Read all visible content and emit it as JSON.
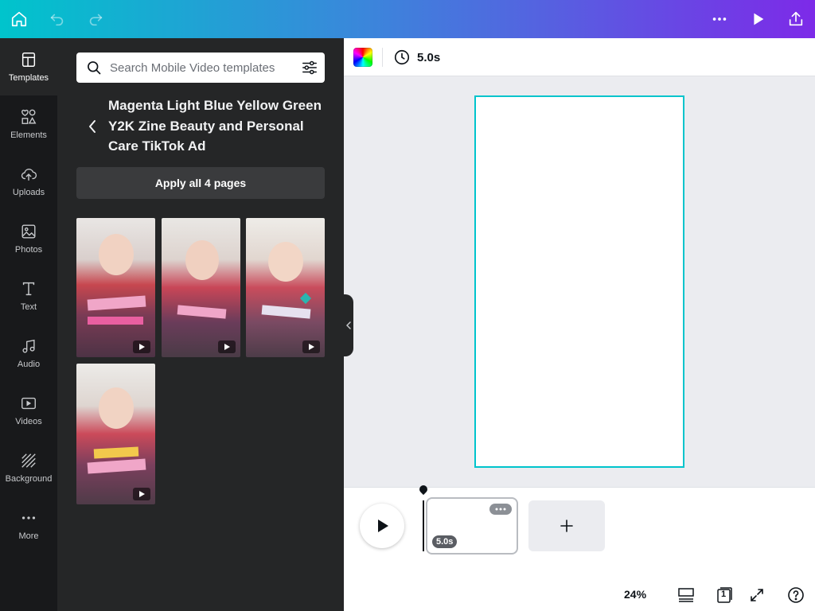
{
  "topbar": {
    "icons": [
      "home-icon",
      "undo-icon",
      "redo-icon",
      "more-icon",
      "play-icon",
      "share-icon"
    ]
  },
  "rail": {
    "items": [
      {
        "label": "Templates",
        "icon": "templates-icon",
        "active": true
      },
      {
        "label": "Elements",
        "icon": "elements-icon"
      },
      {
        "label": "Uploads",
        "icon": "upload-cloud-icon"
      },
      {
        "label": "Photos",
        "icon": "photo-icon"
      },
      {
        "label": "Text",
        "icon": "text-icon"
      },
      {
        "label": "Audio",
        "icon": "music-note-icon"
      },
      {
        "label": "Videos",
        "icon": "video-icon"
      },
      {
        "label": "Background",
        "icon": "background-hatch-icon"
      },
      {
        "label": "More",
        "icon": "more-dots-icon"
      }
    ]
  },
  "panel": {
    "search_placeholder": "Search Mobile Video templates",
    "template_title": "Magenta Light Blue Yellow Green Y2K Zine Beauty and Personal Care TikTok Ad",
    "apply_label": "Apply all 4 pages",
    "thumbnails": [
      {
        "page": 1,
        "accent": "#f2c94c"
      },
      {
        "page": 2,
        "accent": "#e84a8a"
      },
      {
        "page": 3,
        "accent": "#2bb5b0"
      },
      {
        "page": 4,
        "accent": "#f2c94c"
      }
    ]
  },
  "editor": {
    "duration": "5.0s"
  },
  "timeline": {
    "page_duration": "5.0s"
  },
  "bottom": {
    "zoom": "24%",
    "page_count": "1"
  },
  "colors": {
    "accent": "#00c4cc",
    "brand_purple": "#7d2ae8",
    "panel_bg": "#252627",
    "rail_bg": "#18191b"
  }
}
